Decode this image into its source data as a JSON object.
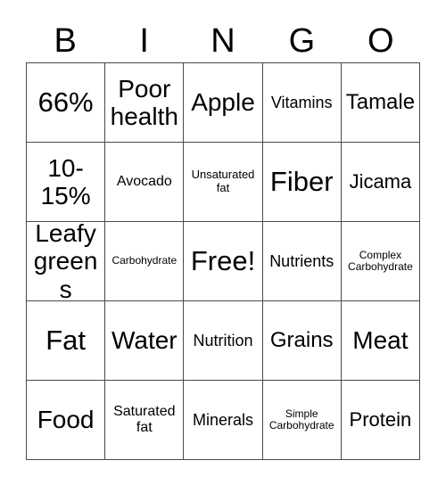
{
  "card": {
    "title_letters": [
      "B",
      "I",
      "N",
      "G",
      "O"
    ],
    "columns": 5,
    "rows": 5,
    "border_color": "#4a4a4a",
    "background_color": "#ffffff",
    "text_color": "#000000",
    "free_space_label": "Free!",
    "free_space_position": "center",
    "cells": [
      [
        {
          "text": "66%",
          "size": "fs-4xl"
        },
        {
          "text": "Poor\nhealth",
          "size": "fs-3xl"
        },
        {
          "text": "Apple",
          "size": "fs-3xl"
        },
        {
          "text": "Vitamins",
          "size": "fs-lg"
        },
        {
          "text": "Tamale",
          "size": "fs-2xl"
        }
      ],
      [
        {
          "text": "10-\n15%",
          "size": "fs-3xl"
        },
        {
          "text": "Avocado",
          "size": "fs-md"
        },
        {
          "text": "Unsaturated\nfat",
          "size": "fs-sm"
        },
        {
          "text": "Fiber",
          "size": "fs-4xl"
        },
        {
          "text": "Jicama",
          "size": "fs-xl"
        }
      ],
      [
        {
          "text": "Leafy\ngreens",
          "size": "fs-3xl"
        },
        {
          "text": "Carbohydrate",
          "size": "fs-xs"
        },
        {
          "text": "Free!",
          "size": "fs-4xl"
        },
        {
          "text": "Nutrients",
          "size": "fs-lg"
        },
        {
          "text": "Complex\nCarbohydrate",
          "size": "fs-xs"
        }
      ],
      [
        {
          "text": "Fat",
          "size": "fs-4xl"
        },
        {
          "text": "Water",
          "size": "fs-3xl"
        },
        {
          "text": "Nutrition",
          "size": "fs-lg"
        },
        {
          "text": "Grains",
          "size": "fs-2xl"
        },
        {
          "text": "Meat",
          "size": "fs-3xl"
        }
      ],
      [
        {
          "text": "Food",
          "size": "fs-3xl"
        },
        {
          "text": "Saturated\nfat",
          "size": "fs-md"
        },
        {
          "text": "Minerals",
          "size": "fs-lg"
        },
        {
          "text": "Simple\nCarbohydrate",
          "size": "fs-xs"
        },
        {
          "text": "Protein",
          "size": "fs-xl"
        }
      ]
    ]
  }
}
